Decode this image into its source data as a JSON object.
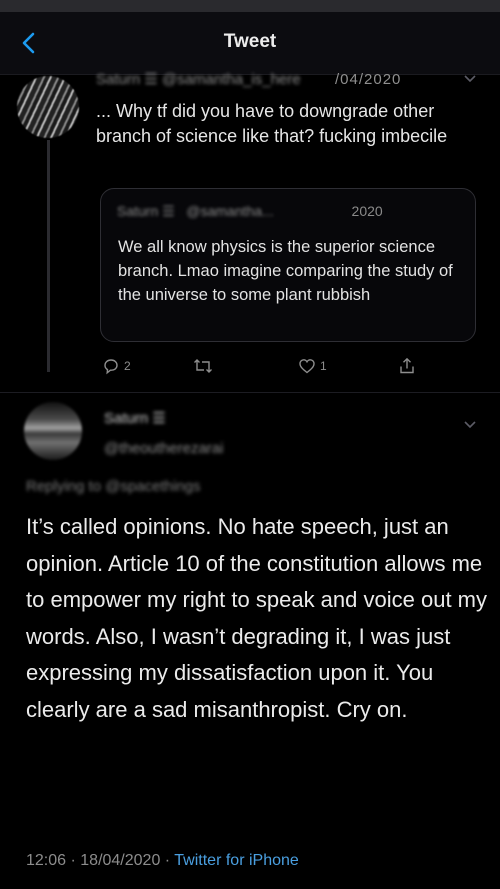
{
  "header": {
    "title": "Tweet",
    "back_icon": "chevron-left-icon"
  },
  "parent_tweet": {
    "name_blurred": "Saturn ☰ @samantha_is_here",
    "date_visible": "/04/2020",
    "text": "... Why tf did you have to downgrade other branch of science like that?  fucking imbecile",
    "quoted_tweet": {
      "name_blurred": "Saturn ☰",
      "handle_blurred": "@samantha...",
      "date_visible": "2020",
      "text": "We all know physics is the superior science branch. Lmao imagine comparing the study of the universe to some plant rubbish"
    },
    "actions": {
      "reply_count": "2",
      "retweet_count": "",
      "like_count": "1"
    }
  },
  "reply_tweet": {
    "name_blurred": "Saturn ☰",
    "handle_blurred": "@theoutherezarai",
    "replying_to_blurred": "Replying to @spacethings",
    "text": "It’s called opinions. No hate speech, just an opinion. Article 10 of the constitution allows me to empower my right to speak and voice out my words. Also, I wasn’t degrading it, I was just expressing my dissatisfaction upon it. You clearly are a sad misanthropist. Cry on.",
    "time": "12:06",
    "date": "18/04/2020",
    "separator": " · ",
    "source": "Twitter for iPhone"
  },
  "colors": {
    "background": "#000000",
    "header_bg": "#0c0c10",
    "text": "#e6e6e6",
    "muted": "#8c8c8c",
    "link": "#4a9fe0",
    "accent": "#1d9bf0"
  }
}
